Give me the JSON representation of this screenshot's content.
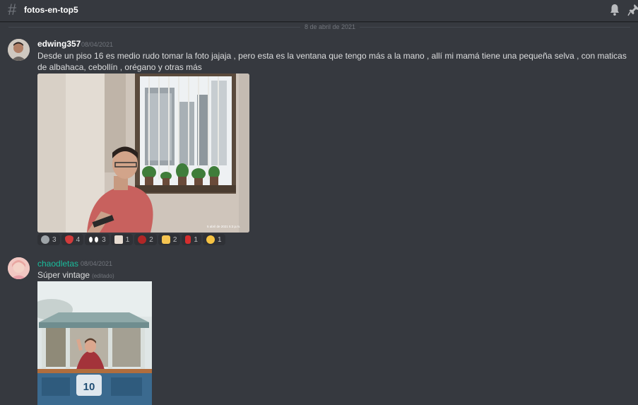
{
  "channel": {
    "name": "fotos-en-top5"
  },
  "date_divider": "8 de abril de 2021",
  "messages": [
    {
      "author": "edwing357",
      "timestamp": "08/04/2021",
      "text": "Desde un piso 16 es medio rudo tomar la foto jajaja , pero esta es la ventana que tengo más a la mano , allí mi mamá tiene una pequeña selva , con maticas de albahaca, cebollín , orégano y otras más",
      "photo_caption": "5 abril de 2021 5:3 p.m.",
      "reactions": [
        {
          "emoji": "alien-icon",
          "count": "3"
        },
        {
          "emoji": "lips-icon",
          "count": "4"
        },
        {
          "emoji": "eyes-icon",
          "count": "3"
        },
        {
          "emoji": "cat-icon",
          "count": "1"
        },
        {
          "emoji": "lips-dark-icon",
          "count": "2"
        },
        {
          "emoji": "thumbs-up-icon",
          "count": "2"
        },
        {
          "emoji": "red-figure-icon",
          "count": "1"
        },
        {
          "emoji": "hugging-face-icon",
          "count": "1"
        }
      ]
    },
    {
      "author": "chaodletas",
      "timestamp": "08/04/2021",
      "text": "Súper vintage",
      "edited": "(editado)",
      "photo_badge": "10"
    }
  ],
  "colors": {
    "background": "#36393f",
    "username_alt": "#1abc9c",
    "reaction_bg": "#2f3136"
  }
}
